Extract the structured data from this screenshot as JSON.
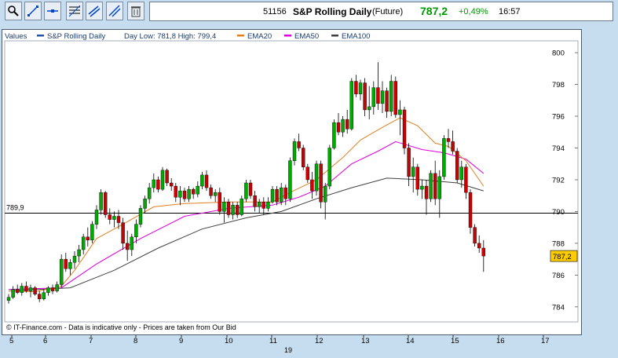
{
  "toolbar": {
    "icons": [
      "zoom-icon",
      "draw-line-icon",
      "horizontal-line-icon",
      "fibonacci-icon",
      "trend-channel-icon",
      "parallel-lines-icon",
      "trash-icon"
    ]
  },
  "header": {
    "code": "51156",
    "title": "S&P Rolling Daily",
    "type": "(Future)",
    "price": "787,2",
    "change": "+0,49%",
    "time": "16:57"
  },
  "legend": {
    "values": "Values",
    "series_name": "S&P Rolling Daily",
    "day_range": "Day Low: 781,8 High: 799,4",
    "ema20": "EMA20",
    "ema50": "EMA50",
    "ema100": "EMA100"
  },
  "footer_text": "© IT-Finance.com - Data is indicative only - Prices are taken from Our Bid",
  "ref_label": "789,9",
  "price_tag": "787,2",
  "colors": {
    "up": "#00aa00",
    "down": "#cc0000",
    "ema20": "#e08020",
    "ema50": "#dd00dd",
    "ema100": "#404040",
    "ref": "#000000",
    "tag": "#ffcc00"
  },
  "chart_data": {
    "type": "candlestick",
    "x_ticks": [
      "5",
      "6",
      "7",
      "8",
      "9",
      "10",
      "11",
      "12",
      "13",
      "14",
      "15",
      "16",
      "17"
    ],
    "x_sub_label": "19",
    "y_ticks": [
      "800",
      "798",
      "796",
      "794",
      "792",
      "790",
      "788",
      "786",
      "784"
    ],
    "ylim": [
      783.3,
      800.4
    ],
    "reference_level": 789.9,
    "last_price": 787.2,
    "candles": [
      [
        784.4,
        784.8,
        784.2,
        784.6
      ],
      [
        784.6,
        785.3,
        784.5,
        785.1
      ],
      [
        785.1,
        785.4,
        784.8,
        784.9
      ],
      [
        784.9,
        785.5,
        784.7,
        785.3
      ],
      [
        785.3,
        785.6,
        784.9,
        785.0
      ],
      [
        785.0,
        785.4,
        784.6,
        785.2
      ],
      [
        785.2,
        785.3,
        784.7,
        784.8
      ],
      [
        784.8,
        785.0,
        784.3,
        784.5
      ],
      [
        784.5,
        785.1,
        784.4,
        784.9
      ],
      [
        784.9,
        785.3,
        784.7,
        785.2
      ],
      [
        785.2,
        785.4,
        784.8,
        785.0
      ],
      [
        785.0,
        785.6,
        784.9,
        785.4
      ],
      [
        785.4,
        787.3,
        785.2,
        787.0
      ],
      [
        787.0,
        787.4,
        786.2,
        786.4
      ],
      [
        786.4,
        787.0,
        786.0,
        786.8
      ],
      [
        786.8,
        787.5,
        786.4,
        787.2
      ],
      [
        787.2,
        787.9,
        786.8,
        787.6
      ],
      [
        787.6,
        788.6,
        787.3,
        788.4
      ],
      [
        788.4,
        789.0,
        787.8,
        788.2
      ],
      [
        788.2,
        789.4,
        788.0,
        789.2
      ],
      [
        789.2,
        790.4,
        788.9,
        790.1
      ],
      [
        790.1,
        791.4,
        789.8,
        791.2
      ],
      [
        791.2,
        791.3,
        789.6,
        789.8
      ],
      [
        789.8,
        790.2,
        789.2,
        789.5
      ],
      [
        789.5,
        790.0,
        789.0,
        789.7
      ],
      [
        789.7,
        790.1,
        788.9,
        789.3
      ],
      [
        789.3,
        789.6,
        787.6,
        788.0
      ],
      [
        788.0,
        788.8,
        786.9,
        787.6
      ],
      [
        787.6,
        788.6,
        787.2,
        788.4
      ],
      [
        788.4,
        789.5,
        788.0,
        789.2
      ],
      [
        789.2,
        790.4,
        789.0,
        790.2
      ],
      [
        790.2,
        791.0,
        789.9,
        790.8
      ],
      [
        790.8,
        791.8,
        790.5,
        791.5
      ],
      [
        791.5,
        792.4,
        791.2,
        792.0
      ],
      [
        792.0,
        792.2,
        791.2,
        791.4
      ],
      [
        791.4,
        792.8,
        791.3,
        792.6
      ],
      [
        792.6,
        792.7,
        791.6,
        791.8
      ],
      [
        791.8,
        792.1,
        791.3,
        791.6
      ],
      [
        791.6,
        791.8,
        790.6,
        790.9
      ],
      [
        790.9,
        791.6,
        790.4,
        791.3
      ],
      [
        791.3,
        791.5,
        790.6,
        790.8
      ],
      [
        790.8,
        791.6,
        790.6,
        791.4
      ],
      [
        791.4,
        791.5,
        790.8,
        791.1
      ],
      [
        791.1,
        791.9,
        790.9,
        791.6
      ],
      [
        791.6,
        792.5,
        791.4,
        792.3
      ],
      [
        792.3,
        792.6,
        791.3,
        791.5
      ],
      [
        791.5,
        791.7,
        790.8,
        791.0
      ],
      [
        791.0,
        791.4,
        790.6,
        791.2
      ],
      [
        791.2,
        791.5,
        789.8,
        790.0
      ],
      [
        790.0,
        790.9,
        789.3,
        790.6
      ],
      [
        790.6,
        790.8,
        789.6,
        789.8
      ],
      [
        789.8,
        790.6,
        789.5,
        790.4
      ],
      [
        790.4,
        790.6,
        789.6,
        789.8
      ],
      [
        789.8,
        791.0,
        789.7,
        790.8
      ],
      [
        790.8,
        792.0,
        790.6,
        791.8
      ],
      [
        791.8,
        792.0,
        790.8,
        791.0
      ],
      [
        791.0,
        791.3,
        790.0,
        790.3
      ],
      [
        790.3,
        790.8,
        789.9,
        790.6
      ],
      [
        790.6,
        790.9,
        789.8,
        790.2
      ],
      [
        790.2,
        790.9,
        790.0,
        790.6
      ],
      [
        790.6,
        791.6,
        790.5,
        791.4
      ],
      [
        791.4,
        791.6,
        790.4,
        790.6
      ],
      [
        790.6,
        791.8,
        790.4,
        791.5
      ],
      [
        791.5,
        791.7,
        790.4,
        790.8
      ],
      [
        790.8,
        793.4,
        790.6,
        793.2
      ],
      [
        793.2,
        794.6,
        792.9,
        794.4
      ],
      [
        794.4,
        794.9,
        793.8,
        794.0
      ],
      [
        794.0,
        794.2,
        792.6,
        792.8
      ],
      [
        792.8,
        793.0,
        791.8,
        792.0
      ],
      [
        792.0,
        792.5,
        790.8,
        791.3
      ],
      [
        791.3,
        793.2,
        791.0,
        793.0
      ],
      [
        793.0,
        793.2,
        790.2,
        790.6
      ],
      [
        790.6,
        791.8,
        789.5,
        791.6
      ],
      [
        791.6,
        794.2,
        791.4,
        794.0
      ],
      [
        794.0,
        795.8,
        793.9,
        795.6
      ],
      [
        795.6,
        796.2,
        794.8,
        795.0
      ],
      [
        795.0,
        796.0,
        794.7,
        795.8
      ],
      [
        795.8,
        796.4,
        794.9,
        795.2
      ],
      [
        795.2,
        798.4,
        795.1,
        798.2
      ],
      [
        798.2,
        798.6,
        797.2,
        797.4
      ],
      [
        797.4,
        798.3,
        797.0,
        798.1
      ],
      [
        798.1,
        798.4,
        796.0,
        796.4
      ],
      [
        796.4,
        797.9,
        795.8,
        796.6
      ],
      [
        796.6,
        798.2,
        796.1,
        797.8
      ],
      [
        797.8,
        799.4,
        796.4,
        796.8
      ],
      [
        796.8,
        798.2,
        796.2,
        797.6
      ],
      [
        797.6,
        797.8,
        795.9,
        796.3
      ],
      [
        796.3,
        798.6,
        796.0,
        798.2
      ],
      [
        798.2,
        798.5,
        795.9,
        796.1
      ],
      [
        796.1,
        797.0,
        794.8,
        796.4
      ],
      [
        796.4,
        796.6,
        793.6,
        794.0
      ],
      [
        794.0,
        794.3,
        791.6,
        792.2
      ],
      [
        792.2,
        793.4,
        791.2,
        792.8
      ],
      [
        792.8,
        793.0,
        791.0,
        791.4
      ],
      [
        791.4,
        792.0,
        790.8,
        791.6
      ],
      [
        791.6,
        792.0,
        789.8,
        790.8
      ],
      [
        790.8,
        792.6,
        790.6,
        792.4
      ],
      [
        792.4,
        793.2,
        790.4,
        790.8
      ],
      [
        790.8,
        792.6,
        789.6,
        792.2
      ],
      [
        792.2,
        794.8,
        792.0,
        794.6
      ],
      [
        794.6,
        795.2,
        794.0,
        794.4
      ],
      [
        794.4,
        795.1,
        793.6,
        793.8
      ],
      [
        793.8,
        794.0,
        791.8,
        792.0
      ],
      [
        792.0,
        793.2,
        791.5,
        792.8
      ],
      [
        792.8,
        793.0,
        790.8,
        791.2
      ],
      [
        791.2,
        791.4,
        788.6,
        789.0
      ],
      [
        789.0,
        789.2,
        787.8,
        788.0
      ],
      [
        788.0,
        788.5,
        787.4,
        787.7
      ],
      [
        787.7,
        788.2,
        786.2,
        787.2
      ]
    ],
    "ema20": [
      [
        0,
        785.0
      ],
      [
        6,
        784.95
      ],
      [
        12,
        785.3
      ],
      [
        15,
        786.3
      ],
      [
        20,
        788.3
      ],
      [
        26,
        789.2
      ],
      [
        33,
        790.3
      ],
      [
        40,
        790.5
      ],
      [
        50,
        790.6
      ],
      [
        60,
        790.6
      ],
      [
        64,
        791.2
      ],
      [
        70,
        792.0
      ],
      [
        76,
        793.4
      ],
      [
        80,
        794.5
      ],
      [
        85,
        795.3
      ],
      [
        89,
        795.9
      ],
      [
        93,
        795.4
      ],
      [
        97,
        794.3
      ],
      [
        100,
        794.1
      ],
      [
        104,
        793.2
      ],
      [
        108,
        791.6
      ]
    ],
    "ema50": [
      [
        0,
        785.1
      ],
      [
        12,
        785.2
      ],
      [
        20,
        786.7
      ],
      [
        30,
        788.3
      ],
      [
        40,
        789.7
      ],
      [
        50,
        790.2
      ],
      [
        60,
        790.4
      ],
      [
        66,
        790.9
      ],
      [
        72,
        791.6
      ],
      [
        78,
        793.0
      ],
      [
        84,
        793.8
      ],
      [
        88,
        794.4
      ],
      [
        94,
        793.9
      ],
      [
        99,
        793.7
      ],
      [
        104,
        793.3
      ],
      [
        108,
        792.4
      ]
    ],
    "ema100": [
      [
        0,
        785.0
      ],
      [
        14,
        785.2
      ],
      [
        24,
        786.3
      ],
      [
        34,
        787.7
      ],
      [
        44,
        788.9
      ],
      [
        54,
        789.6
      ],
      [
        62,
        790.0
      ],
      [
        70,
        790.8
      ],
      [
        78,
        791.5
      ],
      [
        86,
        792.1
      ],
      [
        94,
        792.0
      ],
      [
        102,
        791.8
      ],
      [
        108,
        791.3
      ]
    ]
  }
}
